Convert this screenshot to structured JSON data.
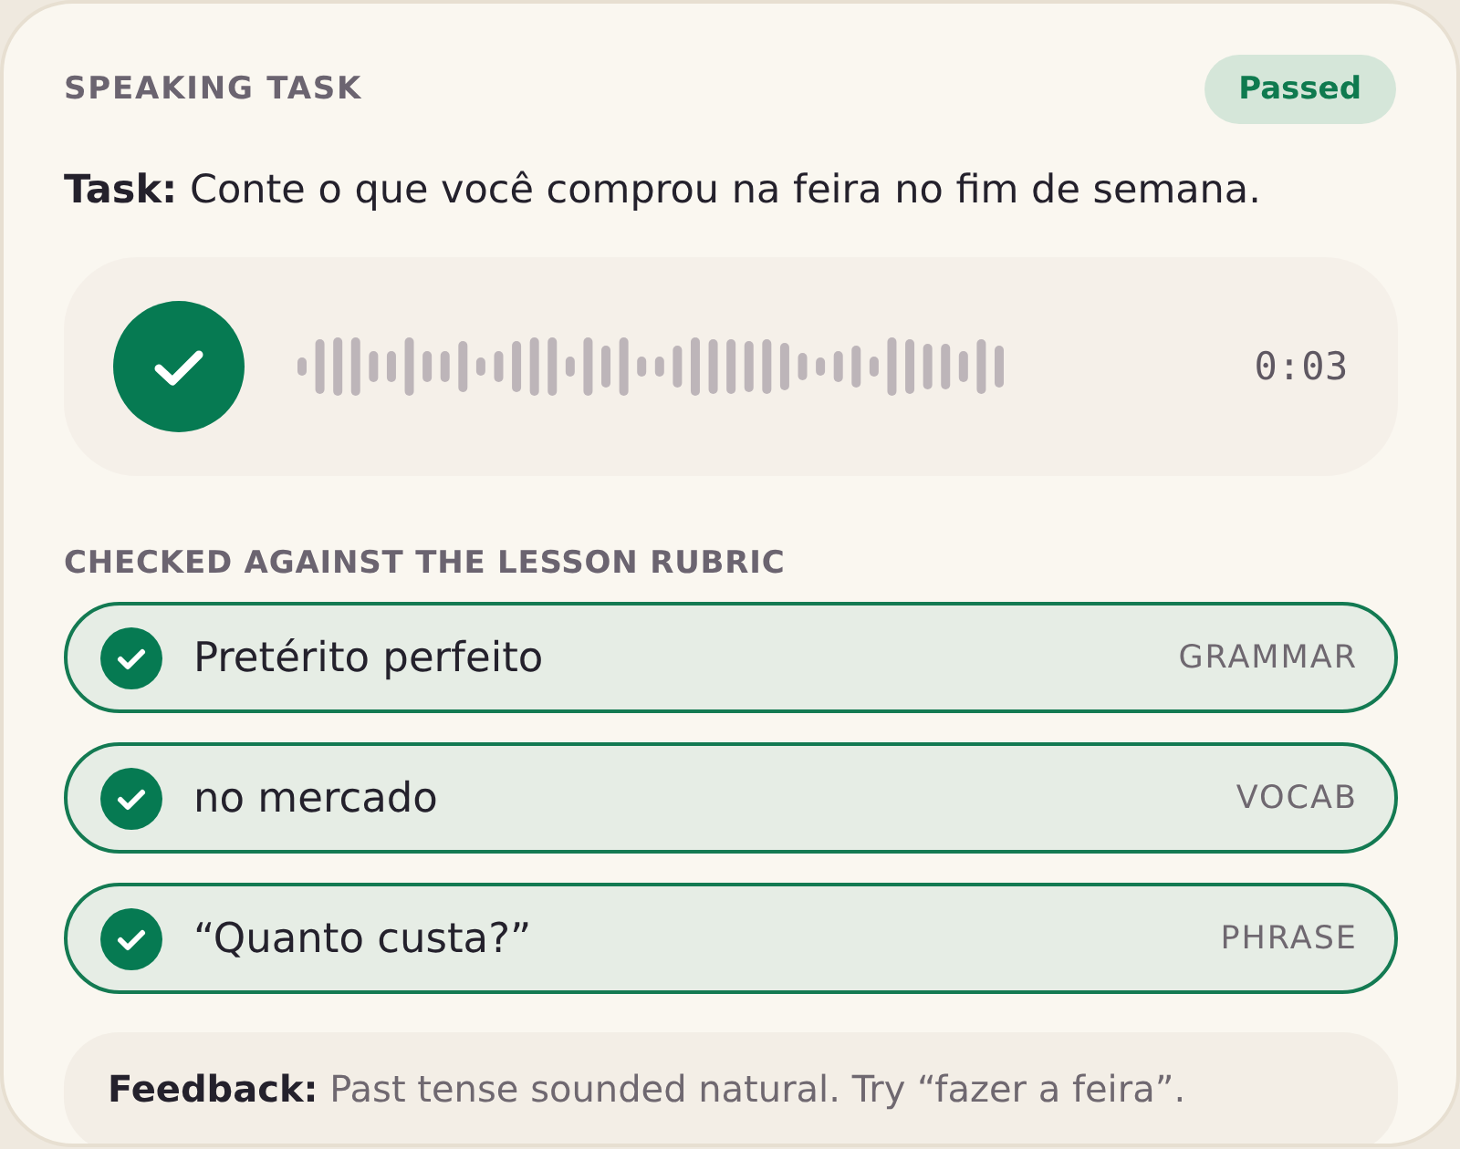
{
  "header": {
    "title": "SPEAKING TASK",
    "badge": "Passed"
  },
  "task": "**Task:** Conte o que você comprou na feira no fim de semana.",
  "recording": {
    "completed": true,
    "duration": "0:03"
  },
  "rubric": {
    "title": "CHECKED AGAINST THE LESSON RUBRIC",
    "items": [
      {
        "label": "Pretérito perfeito",
        "tag": "GRAMMAR",
        "met": true
      },
      {
        "label": "no mercado",
        "tag": "VOCAB",
        "met": true
      },
      {
        "label": "“Quanto custa?”",
        "tag": "PHRASE",
        "met": true
      }
    ]
  },
  "feedback": "**Feedback:** Past tense sounded natural. Try “fazer a feira”."
}
